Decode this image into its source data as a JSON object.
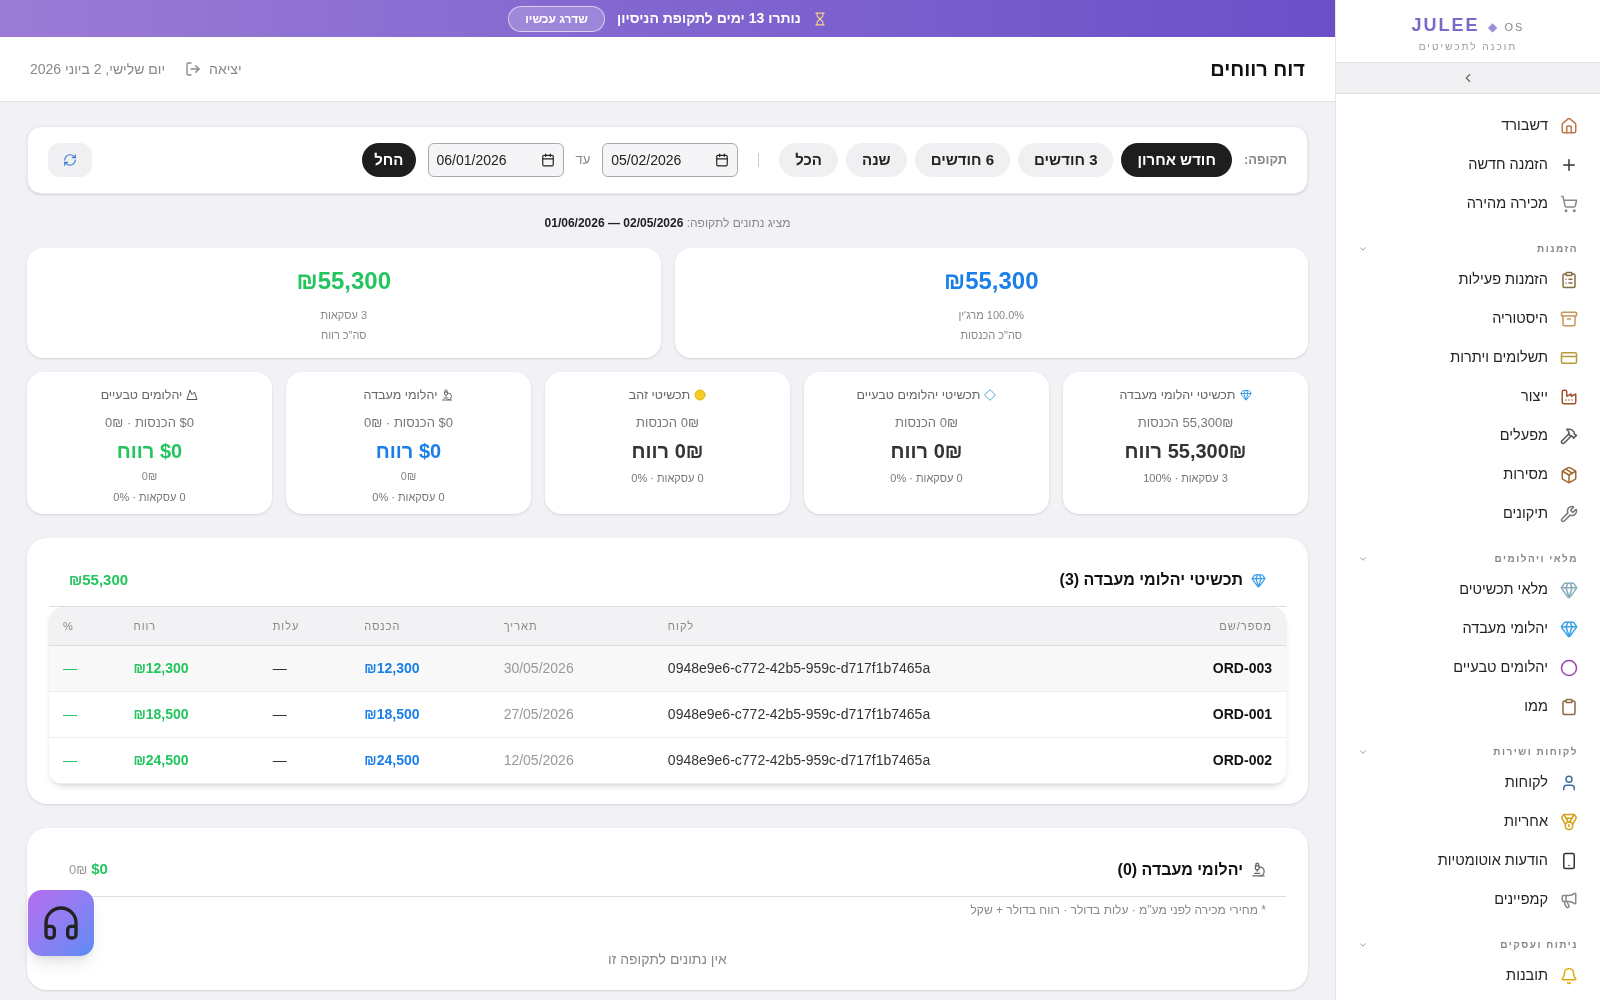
{
  "banner": {
    "text": "נותרו 13 ימים לתקופת הניסיון",
    "button": "שדרג עכשיו"
  },
  "header": {
    "title": "דוח רווחים",
    "logout": "יציאה",
    "date": "יום שלישי, 2 ביוני 2026"
  },
  "filter": {
    "label": "תקופה:",
    "periods": [
      {
        "label": "חודש אחרון",
        "selected": true
      },
      {
        "label": "3 חודשים",
        "selected": false
      },
      {
        "label": "6 חודשים",
        "selected": false
      },
      {
        "label": "שנה",
        "selected": false
      },
      {
        "label": "הכל",
        "selected": false
      }
    ],
    "from": "05/02/2026",
    "to_label": "עד",
    "to": "06/01/2026",
    "apply": "החל"
  },
  "range": "מציג נתונים לתקופה: **02/05/2026 — 01/06/2026**",
  "summary": [
    {
      "kind": "revenue",
      "value": "₪55,300",
      "detail": "100.0% מרג'ין",
      "caption": "סה\"כ הכנסות"
    },
    {
      "kind": "profit",
      "value": "₪55,300",
      "detail": "3 עסקאות",
      "caption": "סה\"כ רווח"
    }
  ],
  "categories": [
    {
      "title": "תכשיטי יהלומי מעבדה",
      "income": "55,300₪ הכנסות",
      "profit": "55,300₪ רווח",
      "color": "#333333",
      "footer": "3 עסקאות · 100%"
    },
    {
      "title": "תכשיטי יהלומים טבעיים",
      "income": "0₪ הכנסות",
      "profit": "0₪ רווח",
      "color": "#333333",
      "footer": "0 עסקאות · 0%"
    },
    {
      "title": "תכשיטי זהב",
      "income": "0₪ הכנסות",
      "profit": "0₪ רווח",
      "color": "#333333",
      "footer": "0 עסקאות · 0%"
    },
    {
      "title": "יהלומי מעבדה",
      "income": "$0 הכנסות · 0₪",
      "profit": "$0 רווח",
      "color": "#1a7fe8",
      "sub": "0₪",
      "footer": "0 עסקאות · 0%"
    },
    {
      "title": "יהלומים טבעיים",
      "income": "$0 הכנסות · 0₪",
      "profit": "$0 רווח",
      "color": "#22c55e",
      "sub": "0₪",
      "footer": "0 עסקאות · 0%"
    }
  ],
  "sections": [
    {
      "title": "תכשיטי יהלומי מעבדה (3)",
      "totals": [
        "₪55,300"
      ],
      "columns": [
        "מספר/שם",
        "לקוח",
        "תאריך",
        "הכנסה",
        "עלות",
        "רווח",
        "%"
      ],
      "rows": [
        [
          "ORD-003",
          "0948e9e6-c772-42b5-959c-d717f1b7465a",
          "30/05/2026",
          "₪12,300",
          "—",
          "₪12,300",
          "—"
        ],
        [
          "ORD-001",
          "0948e9e6-c772-42b5-959c-d717f1b7465a",
          "27/05/2026",
          "₪18,500",
          "—",
          "₪18,500",
          "—"
        ],
        [
          "ORD-002",
          "0948e9e6-c772-42b5-959c-d717f1b7465a",
          "12/05/2026",
          "₪24,500",
          "—",
          "₪24,500",
          "—"
        ]
      ]
    },
    {
      "title": "יהלומי מעבדה (0)",
      "totals": [
        "$0",
        "0₪"
      ],
      "note": "* מחירי מכירה לפני מע\"מ · עלות בדולר · רווח בדולר + שקל",
      "empty": "אין נתונים לתקופה זו"
    }
  ],
  "sidebar": {
    "logo": "JULEE",
    "logo_mark": "◆",
    "logo_suffix": "OS",
    "tagline": "תוכנה לתכשיטים",
    "groups": [
      {
        "items": [
          "דשבורד",
          "הזמנה חדשה",
          "מכירה מהירה"
        ]
      },
      {
        "title": "הזמנות",
        "expanded": true,
        "items": [
          "הזמנות פעילות",
          "היסטוריה",
          "תשלומים ויתרות",
          "ייצור",
          "מפעלים",
          "מסירות",
          "תיקונים"
        ]
      },
      {
        "title": "מלאי ויהלומים",
        "expanded": true,
        "items": [
          "מלאי תכשיטים",
          "יהלומי מעבדה",
          "יהלומים טבעיים",
          "ממו"
        ]
      },
      {
        "title": "לקוחות ושירות",
        "expanded": true,
        "items": [
          "לקוחות",
          "אחריות",
          "הודעות אוטומטיות",
          "קמפיינים"
        ]
      },
      {
        "title": "ניתוח ועסקים",
        "expanded": true,
        "items": [
          "תובנות"
        ]
      }
    ]
  }
}
